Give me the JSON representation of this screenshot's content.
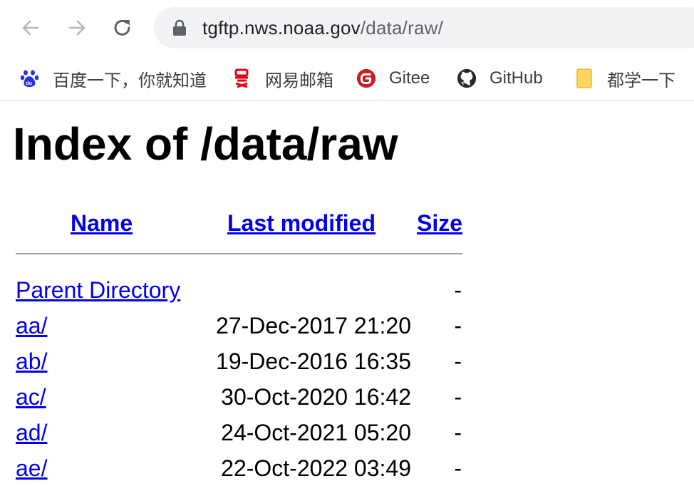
{
  "browser": {
    "url_host": "tgftp.nws.noaa.gov",
    "url_path": "/data/raw/"
  },
  "bookmarks": [
    {
      "label": "百度一下，你就知道",
      "icon": "baidu-paw-icon"
    },
    {
      "label": "网易邮箱",
      "icon": "netease-mail-icon"
    },
    {
      "label": "Gitee",
      "icon": "gitee-icon"
    },
    {
      "label": "GitHub",
      "icon": "github-icon"
    },
    {
      "label": "都学一下",
      "icon": "folder-icon"
    }
  ],
  "page": {
    "title": "Index of /data/raw",
    "headers": {
      "name": "Name",
      "last_modified": "Last modified",
      "size": "Size"
    },
    "rows": [
      {
        "name": "Parent Directory",
        "date": "",
        "size": "-"
      },
      {
        "name": "aa/",
        "date": "27-Dec-2017 21:20",
        "size": "-"
      },
      {
        "name": "ab/",
        "date": "19-Dec-2016 16:35",
        "size": "-"
      },
      {
        "name": "ac/",
        "date": "30-Oct-2020 16:42",
        "size": "-"
      },
      {
        "name": "ad/",
        "date": "24-Oct-2021 05:20",
        "size": "-"
      },
      {
        "name": "ae/",
        "date": "22-Oct-2022 03:49",
        "size": "-"
      }
    ]
  },
  "colors": {
    "link": "#0000ee",
    "omnibox_bg": "#f1f3f4",
    "rule": "#a0a0a0"
  }
}
